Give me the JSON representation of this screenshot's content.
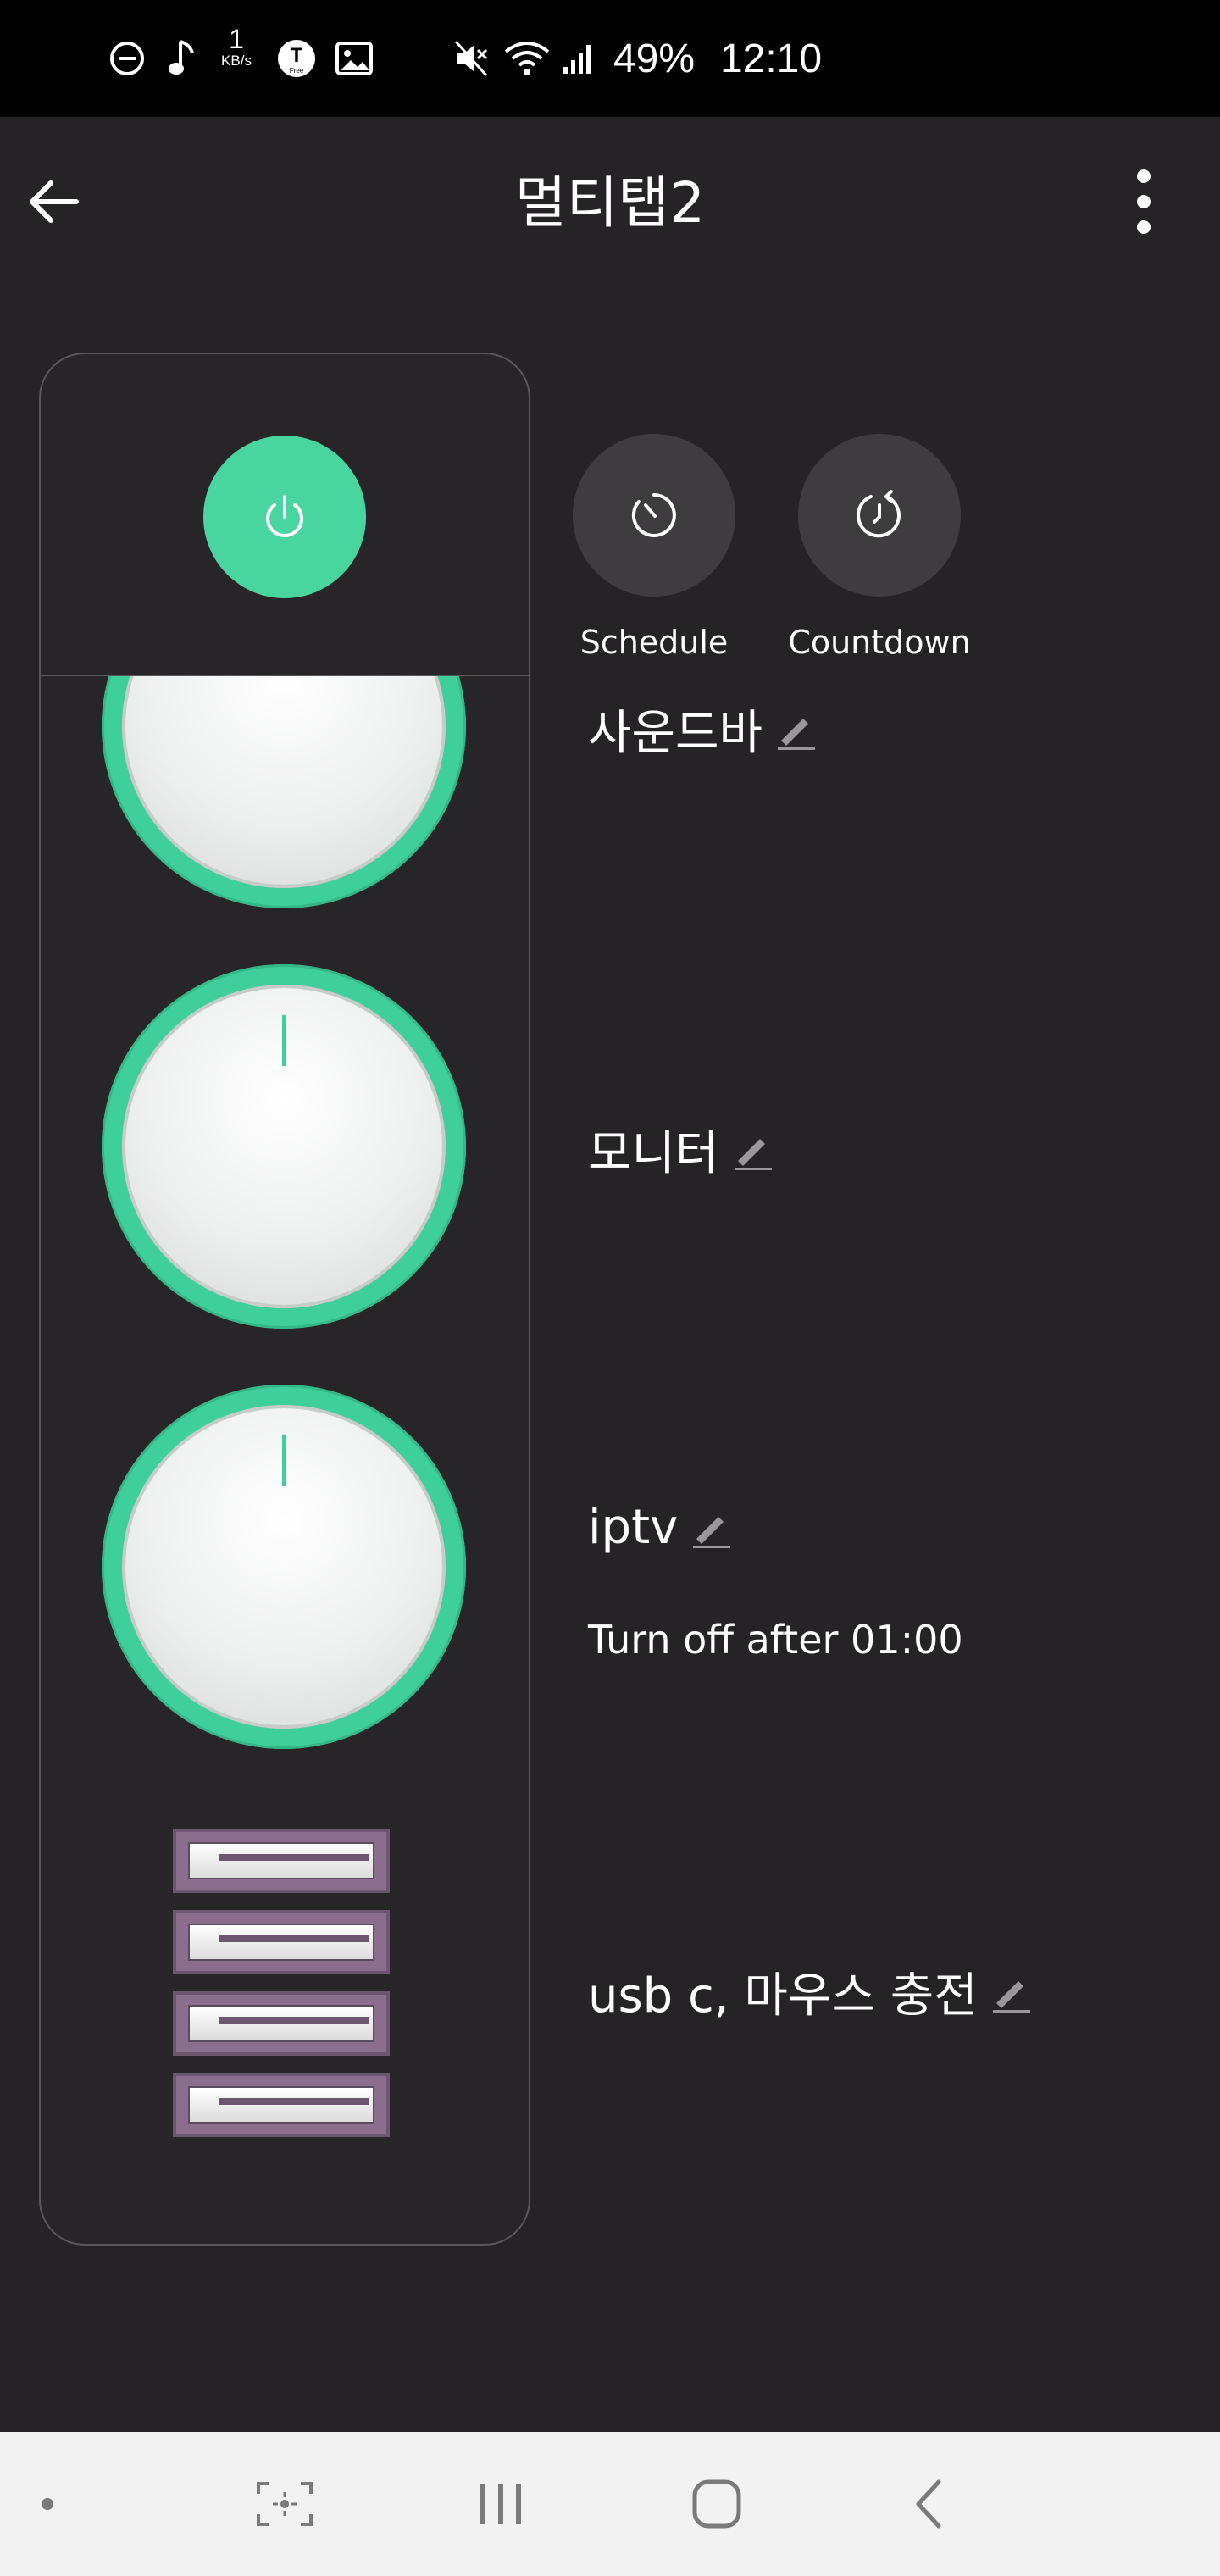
{
  "status_bar": {
    "net_speed_value": "1",
    "net_speed_unit": "KB/s",
    "battery": "49%",
    "time": "12:10",
    "icons": [
      "do-not-disturb-icon",
      "music-note-icon",
      "net-speed-icon",
      "tmap-free-icon",
      "gallery-icon",
      "mute-icon",
      "wifi-icon",
      "signal-icon"
    ]
  },
  "app_bar": {
    "title": "멀티탭2",
    "back_icon": "arrow-left-icon",
    "menu_icon": "more-vert-icon"
  },
  "controls": {
    "schedule_label": "Schedule",
    "countdown_label": "Countdown"
  },
  "outlets": [
    {
      "name": "사운드바",
      "state": "on"
    },
    {
      "name": "모니터",
      "state": "on"
    },
    {
      "name": "iptv",
      "state": "on",
      "timer_text": "Turn off after 01:00"
    },
    {
      "name": "usb c, 마우스 충전",
      "type": "usb"
    }
  ],
  "colors": {
    "accent": "#48d5a0",
    "background": "#252326",
    "usb_purple": "#8b6e8e"
  }
}
